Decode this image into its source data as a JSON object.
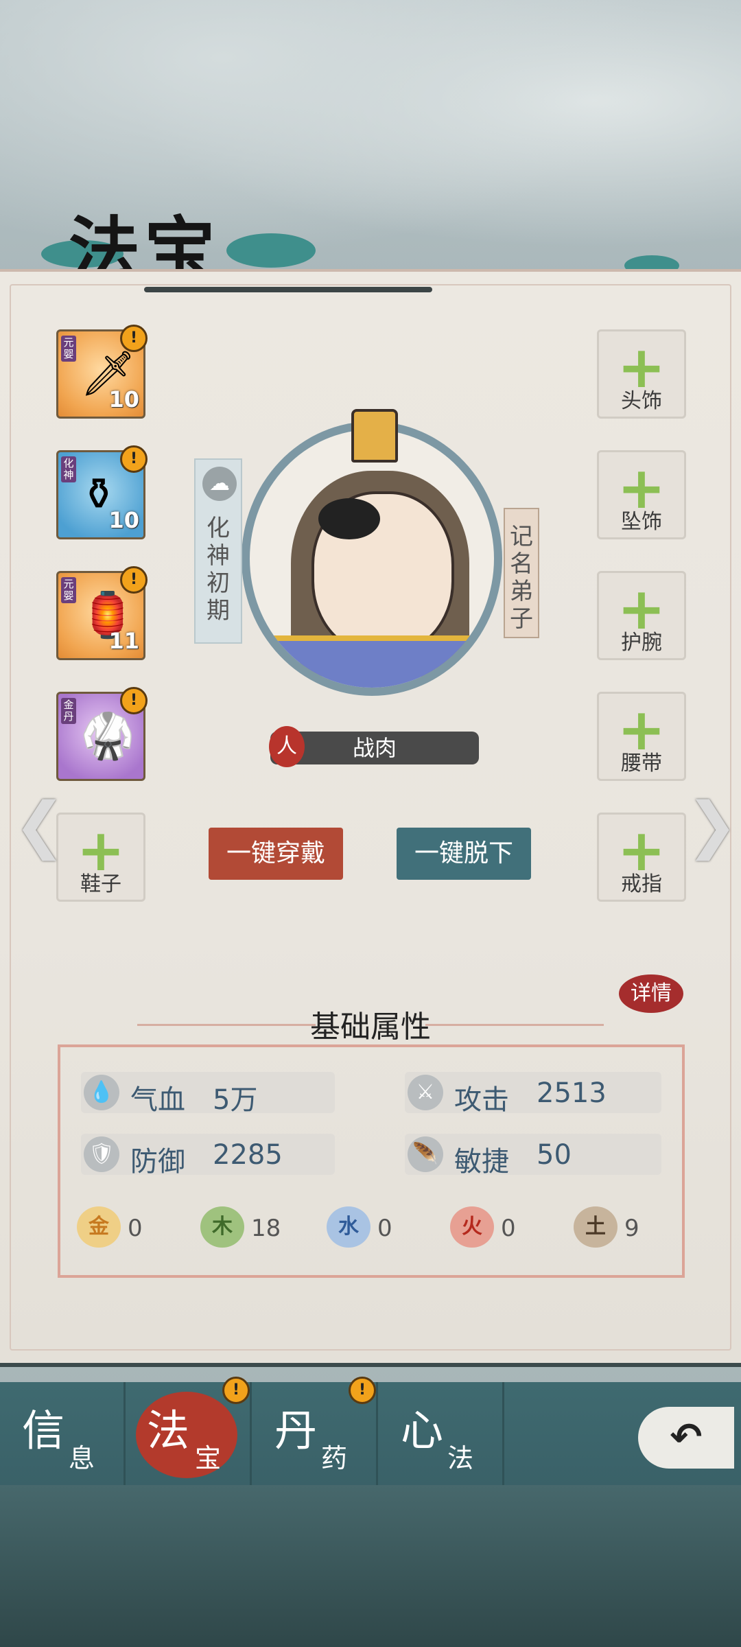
{
  "header": {
    "title": "法宝"
  },
  "left_slots": [
    {
      "tier": "元婴",
      "level": "10",
      "color": "orange",
      "icon": "sword-icon"
    },
    {
      "tier": "化神",
      "level": "10",
      "color": "blue",
      "icon": "bronze-ding-icon"
    },
    {
      "tier": "元婴",
      "level": "11",
      "color": "orange",
      "icon": "pagoda-lantern-icon"
    },
    {
      "tier": "金丹",
      "level": "",
      "color": "purple",
      "icon": "robe-icon"
    },
    {
      "label": "鞋子"
    }
  ],
  "right_slots": [
    {
      "label": "头饰"
    },
    {
      "label": "坠饰"
    },
    {
      "label": "护腕"
    },
    {
      "label": "腰带"
    },
    {
      "label": "戒指"
    }
  ],
  "alert_mark": "!",
  "plus_mark": "+",
  "character": {
    "realm": "化神初期",
    "rank": "记名弟子",
    "race": "人",
    "name": "战肉"
  },
  "buttons": {
    "wear_all": "一键穿戴",
    "remove_all": "一键脱下"
  },
  "attributes": {
    "title": "基础属性",
    "detail": "详情",
    "stats": [
      {
        "name": "气血",
        "value": "5万",
        "icon": "blood-icon"
      },
      {
        "name": "攻击",
        "value": "2513",
        "icon": "attack-icon"
      },
      {
        "name": "防御",
        "value": "2285",
        "icon": "shield-icon"
      },
      {
        "name": "敏捷",
        "value": "50",
        "icon": "wing-icon"
      }
    ],
    "elements": [
      {
        "name": "金",
        "value": "0",
        "color": "#e3b24b"
      },
      {
        "name": "木",
        "value": "18",
        "color": "#7aa35a"
      },
      {
        "name": "水",
        "value": "0",
        "color": "#6b93c7"
      },
      {
        "name": "火",
        "value": "0",
        "color": "#d0584a"
      },
      {
        "name": "土",
        "value": "9",
        "color": "#9b8568"
      }
    ]
  },
  "tabs": [
    {
      "big": "信",
      "small": "息",
      "alert": false
    },
    {
      "big": "法",
      "small": "宝",
      "alert": true,
      "active": true
    },
    {
      "big": "丹",
      "small": "药",
      "alert": true
    },
    {
      "big": "心",
      "small": "法",
      "alert": false
    }
  ],
  "back_icon": "back-arrow-icon",
  "colors": {
    "accent_red": "#b24a36",
    "accent_teal": "#41707a",
    "tab_bg": "#3f6a70"
  }
}
